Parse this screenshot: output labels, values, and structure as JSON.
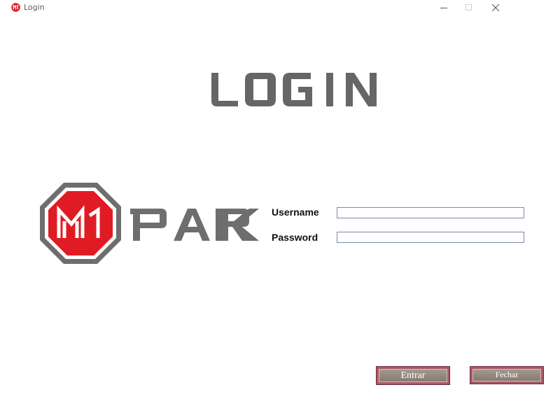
{
  "window": {
    "title": "Login",
    "icon": "m1-park-app-icon",
    "controls": {
      "minimize_icon": "minimize-icon",
      "maximize_icon": "maximize-icon",
      "close_icon": "close-icon"
    }
  },
  "heading": {
    "text": "LOGIN",
    "color": "#666666"
  },
  "logo": {
    "badge_text": "M1",
    "wordmark": "PARK",
    "badge_color": "#e01b24",
    "border_color": "#6e6e6e",
    "wordmark_color": "#6e6e6e"
  },
  "form": {
    "username_label": "Username",
    "password_label": "Password",
    "username_value": "",
    "password_value": ""
  },
  "actions": {
    "enter_label": "Entrar",
    "close_label": "Fechar"
  }
}
